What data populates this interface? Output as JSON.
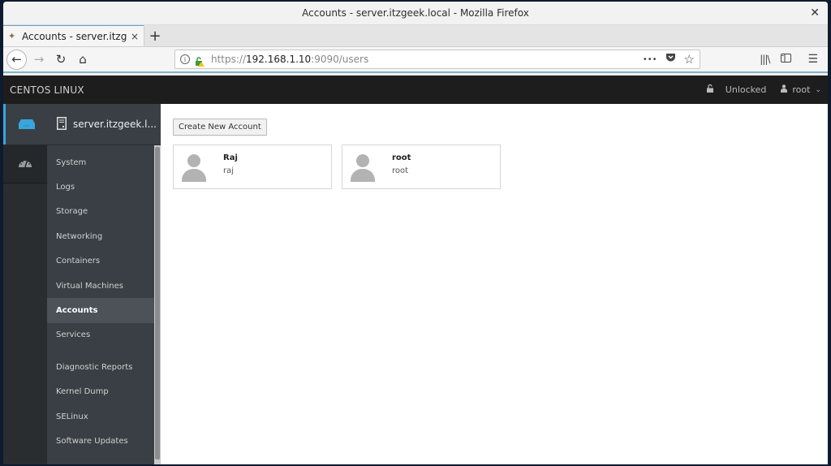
{
  "window": {
    "title": "Accounts - server.itzgeek.local - Mozilla Firefox",
    "close_icon": "close-icon"
  },
  "browser": {
    "tab": {
      "label": "Accounts - server.itzgeek",
      "favicon": "cockpit-favicon",
      "close": "×"
    },
    "new_tab": "+",
    "nav": {
      "back": "←",
      "forward": "→",
      "reload": "↻",
      "home": "⌂"
    },
    "url": {
      "scheme": "https://",
      "host": "192.168.1.10",
      "rest": ":9090/users"
    },
    "url_actions": {
      "more": "•••",
      "pocket": "pocket-icon",
      "bookmark": "☆"
    },
    "toolbar_right": {
      "library": "library-icon",
      "sidebar": "sidebar-icon",
      "menu": "☰"
    }
  },
  "masthead": {
    "brand": "CENTOS LINUX",
    "lock_label": "Unlocked",
    "user_label": "root",
    "user_caret": "⌄"
  },
  "host": {
    "name": "server.itzgeek.l..."
  },
  "sidebar": {
    "items": [
      {
        "label": "System",
        "active": false
      },
      {
        "label": "Logs",
        "active": false
      },
      {
        "label": "Storage",
        "active": false
      },
      {
        "label": "Networking",
        "active": false
      },
      {
        "label": "Containers",
        "active": false
      },
      {
        "label": "Virtual Machines",
        "active": false
      },
      {
        "label": "Accounts",
        "active": true
      },
      {
        "label": "Services",
        "active": false
      },
      {
        "label": "Diagnostic Reports",
        "active": false
      },
      {
        "label": "Kernel Dump",
        "active": false
      },
      {
        "label": "SELinux",
        "active": false
      },
      {
        "label": "Software Updates",
        "active": false
      }
    ]
  },
  "main": {
    "create_button": "Create New Account",
    "accounts": [
      {
        "name": "Raj",
        "username": "raj"
      },
      {
        "name": "root",
        "username": "root"
      }
    ]
  },
  "colors": {
    "accent": "#39a5dc",
    "masthead_bg": "#1d1d1d",
    "nav_bg": "#393f44"
  }
}
